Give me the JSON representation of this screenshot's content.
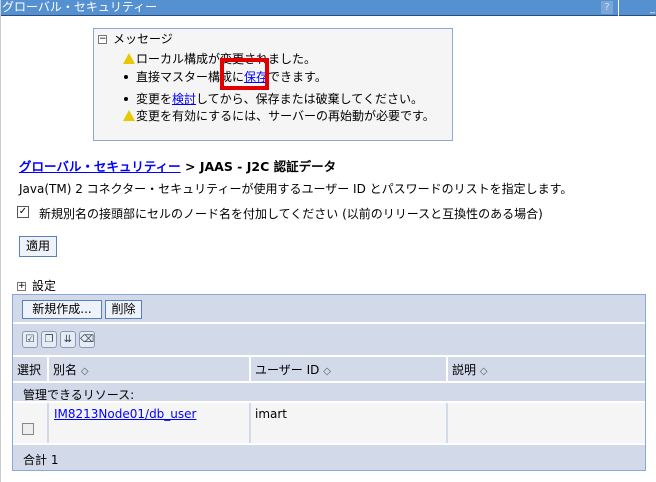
{
  "window": {
    "title": "グローバル・セキュリティー",
    "help": "?",
    "minimize": "_"
  },
  "messages": {
    "header": "メッセージ",
    "line1": "ローカル構成が変更されました。",
    "line2_pre": "直接マスター構成に",
    "line2_link": "保存",
    "line2_post": "できます。",
    "line3_pre": "変更を",
    "line3_link": "検討",
    "line3_post": "してから、保存または破棄してください。",
    "line4": "変更を有効にするには、サーバーの再始動が必要です。"
  },
  "breadcrumb": {
    "link": "グローバル・セキュリティー",
    "sep": " > ",
    "current": "JAAS - J2C 認証データ"
  },
  "description": "Java(TM) 2 コネクター・セキュリティーが使用するユーザー ID とパスワードのリストを指定します。",
  "prefix_option": {
    "checked": true,
    "label": "新規別名の接頭部にセルのノード名を付加してください (以前のリリースと互換性のある場合)"
  },
  "apply_label": "適用",
  "settings_label": "設定",
  "table": {
    "new_label": "新規作成...",
    "delete_label": "削除",
    "headers": {
      "select": "選択",
      "alias": "別名",
      "user_id": "ユーザー ID",
      "description": "説明"
    },
    "group_label": "管理できるリソース:",
    "rows": [
      {
        "alias": "IM8213Node01/db_user",
        "user_id": "imart",
        "description": ""
      }
    ],
    "total_label": "合計",
    "total": "1"
  }
}
